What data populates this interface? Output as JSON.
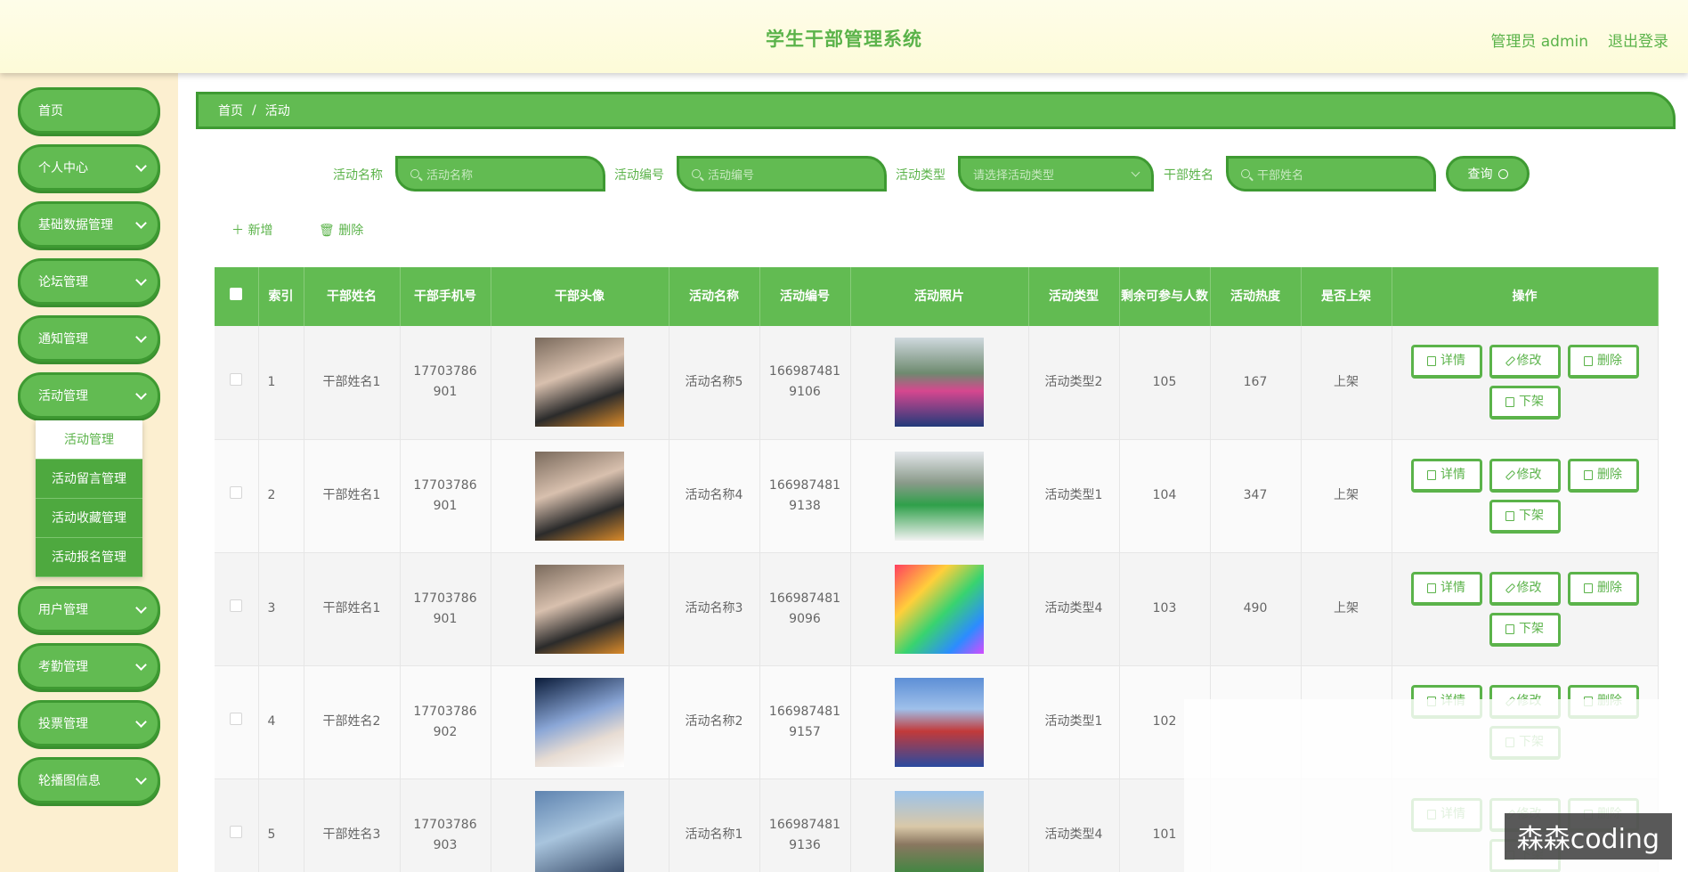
{
  "header": {
    "title": "学生干部管理系统",
    "user": "管理员 admin",
    "logout": "退出登录"
  },
  "sidebar": {
    "items": [
      {
        "label": "首页"
      },
      {
        "label": "个人中心"
      },
      {
        "label": "基础数据管理"
      },
      {
        "label": "论坛管理"
      },
      {
        "label": "通知管理"
      },
      {
        "label": "活动管理"
      },
      {
        "label": "用户管理"
      },
      {
        "label": "考勤管理"
      },
      {
        "label": "投票管理"
      },
      {
        "label": "轮播图信息"
      }
    ],
    "submenu": [
      "活动管理",
      "活动留言管理",
      "活动收藏管理",
      "活动报名管理"
    ]
  },
  "breadcrumb": {
    "home": "首页",
    "sep": "/",
    "current": "活动"
  },
  "search": {
    "name_label": "活动名称",
    "name_placeholder": "活动名称",
    "code_label": "活动编号",
    "code_placeholder": "活动编号",
    "type_label": "活动类型",
    "type_placeholder": "请选择活动类型",
    "cadre_label": "干部姓名",
    "cadre_placeholder": "干部姓名",
    "query": "查询"
  },
  "toolbar": {
    "add": "新增",
    "delete": "删除"
  },
  "table": {
    "headers": [
      "索引",
      "干部姓名",
      "干部手机号",
      "干部头像",
      "活动名称",
      "活动编号",
      "活动照片",
      "活动类型",
      "剩余可参与人数",
      "活动热度",
      "是否上架",
      "操作"
    ],
    "rows": [
      {
        "idx": "1",
        "name": "干部姓名1",
        "phone": "17703786901",
        "act": "活动名称5",
        "code": "1669874819106",
        "type": "活动类型2",
        "left": "105",
        "heat": "167",
        "shelf": "上架"
      },
      {
        "idx": "2",
        "name": "干部姓名1",
        "phone": "17703786901",
        "act": "活动名称4",
        "code": "1669874819138",
        "type": "活动类型1",
        "left": "104",
        "heat": "347",
        "shelf": "上架"
      },
      {
        "idx": "3",
        "name": "干部姓名1",
        "phone": "17703786901",
        "act": "活动名称3",
        "code": "1669874819096",
        "type": "活动类型4",
        "left": "103",
        "heat": "490",
        "shelf": "上架"
      },
      {
        "idx": "4",
        "name": "干部姓名2",
        "phone": "17703786902",
        "act": "活动名称2",
        "code": "1669874819157",
        "type": "活动类型1",
        "left": "102",
        "heat": "",
        "shelf": ""
      },
      {
        "idx": "5",
        "name": "干部姓名3",
        "phone": "17703786903",
        "act": "活动名称1",
        "code": "1669874819136",
        "type": "活动类型4",
        "left": "101",
        "heat": "",
        "shelf": ""
      }
    ],
    "ops": {
      "detail": "详情",
      "edit": "修改",
      "delete": "删除",
      "off": "下架"
    }
  },
  "watermark": "森森coding"
}
